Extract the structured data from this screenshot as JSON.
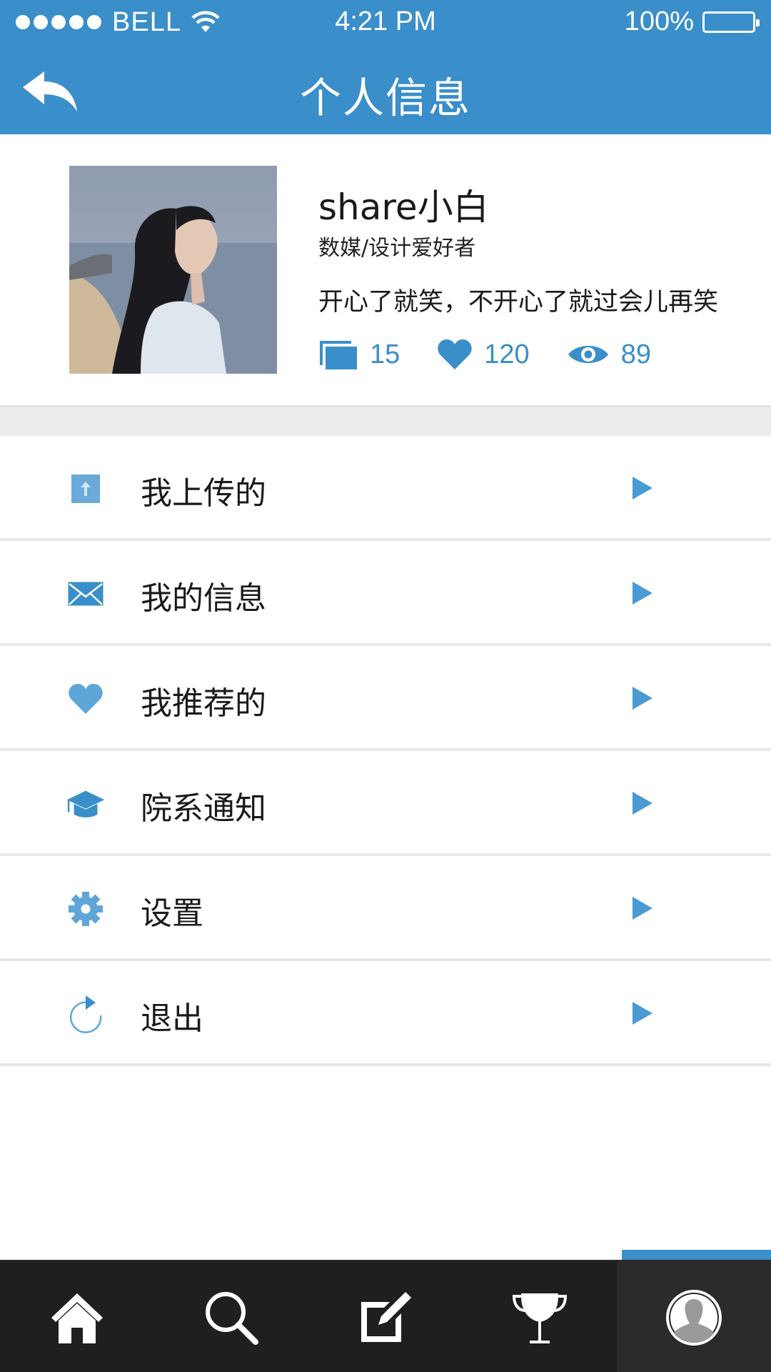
{
  "status_bar": {
    "carrier": "BELL",
    "time": "4:21 PM",
    "battery": "100%"
  },
  "header": {
    "title": "个人信息",
    "back_icon": "back-reply-icon",
    "color": "#3a8ec9"
  },
  "profile": {
    "name": "share小白",
    "tag": "数媒/设计爱好者",
    "bio": "开心了就笑，不开心了就过会儿再笑",
    "stats": [
      {
        "icon": "albums-icon",
        "value": "15"
      },
      {
        "icon": "heart-icon",
        "value": "120"
      },
      {
        "icon": "eye-icon",
        "value": "89"
      }
    ]
  },
  "menu": {
    "items": [
      {
        "icon": "upload-icon",
        "label": "我上传的"
      },
      {
        "icon": "mail-icon",
        "label": "我的信息"
      },
      {
        "icon": "heart-icon",
        "label": "我推荐的"
      },
      {
        "icon": "graduation-cap-icon",
        "label": "院系通知"
      },
      {
        "icon": "gear-icon",
        "label": "设置"
      },
      {
        "icon": "refresh-icon",
        "label": "退出"
      }
    ]
  },
  "tabbar": {
    "tabs": [
      {
        "icon": "home-icon"
      },
      {
        "icon": "search-icon"
      },
      {
        "icon": "edit-icon"
      },
      {
        "icon": "trophy-icon"
      },
      {
        "icon": "user-icon",
        "active": true
      }
    ],
    "accent": "#3a8ec9"
  }
}
